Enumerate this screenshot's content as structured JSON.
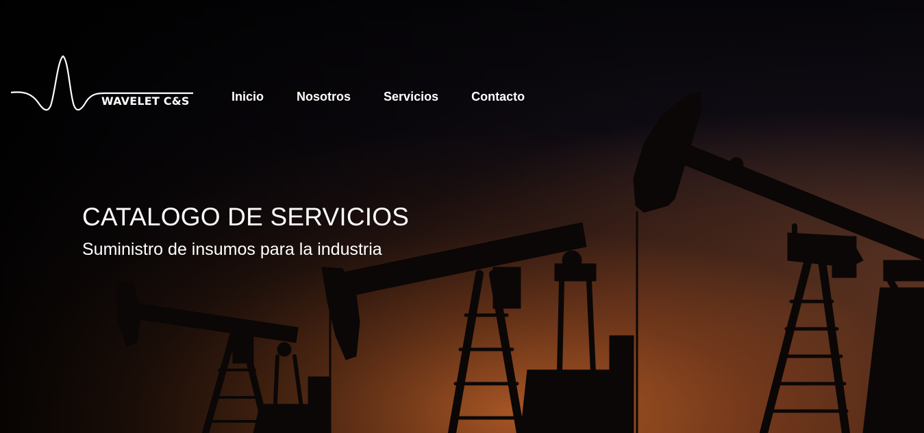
{
  "header": {
    "logo_text": "WAVELET C&S",
    "nav": [
      {
        "label": "Inicio"
      },
      {
        "label": "Nosotros"
      },
      {
        "label": "Servicios"
      },
      {
        "label": "Contacto"
      }
    ]
  },
  "hero": {
    "title": "CATALOGO DE SERVICIOS",
    "subtitle": "Suministro de insumos para la industria",
    "background_image": "oil-pumpjacks-silhouette-sunset"
  },
  "colors": {
    "text": "#ffffff",
    "background_dark": "#07060a",
    "sunset_orange": "#d26928"
  }
}
